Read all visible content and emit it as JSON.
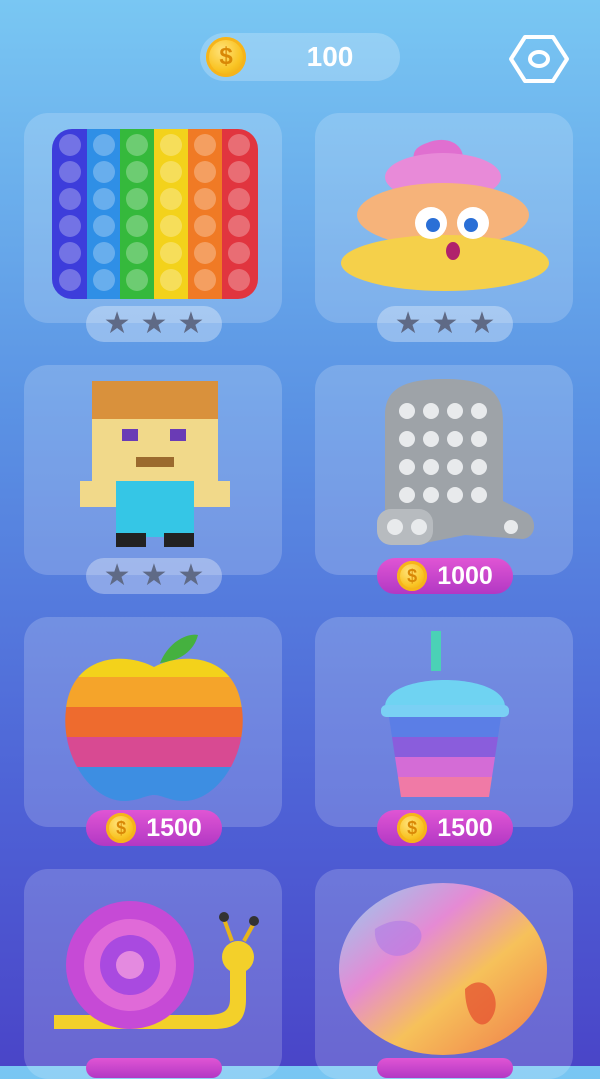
{
  "header": {
    "coins": "100",
    "coin_symbol": "$",
    "settings_icon": "settings-hexagon-icon"
  },
  "items": [
    {
      "name": "Rainbow rectangle",
      "status": "stars",
      "stars": 3
    },
    {
      "name": "Poop emoji",
      "status": "stars",
      "stars": 3
    },
    {
      "name": "Block man",
      "status": "stars",
      "stars": 3
    },
    {
      "name": "Silver crewmate",
      "status": "locked",
      "price": "1000"
    },
    {
      "name": "Rainbow apple",
      "status": "locked",
      "price": "1500"
    },
    {
      "name": "Rainbow cup",
      "status": "locked",
      "price": "1500"
    },
    {
      "name": "Snail",
      "status": "locked"
    },
    {
      "name": "Marble oval",
      "status": "locked"
    }
  ],
  "colors": {
    "background_top": "#79c7f3",
    "background_bottom": "#4a45c8",
    "price_badge": "#c845cc",
    "coin": "#f9c322",
    "star": "#5f6a86"
  }
}
